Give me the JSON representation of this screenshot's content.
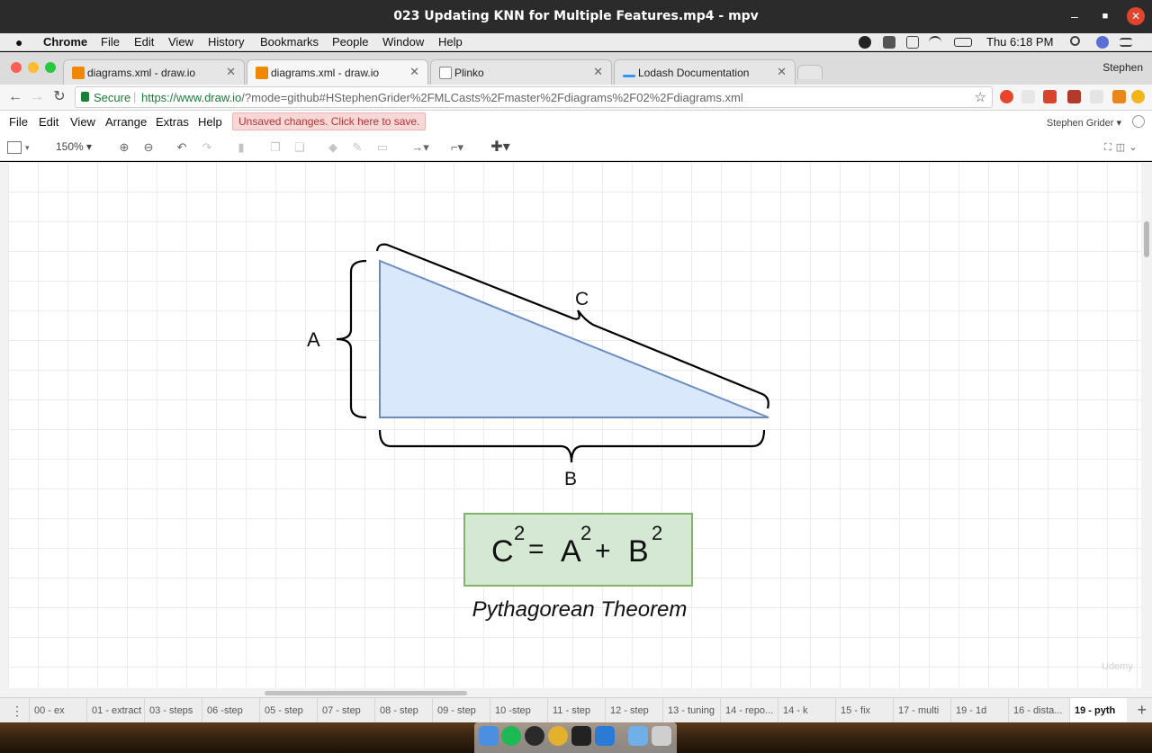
{
  "window": {
    "title": "023 Updating KNN for Multiple Features.mp4 - mpv",
    "minimize": "–",
    "maximize": "■",
    "close": "✕"
  },
  "menubar": {
    "app": "Chrome",
    "items": [
      "File",
      "Edit",
      "View",
      "History",
      "Bookmarks",
      "People",
      "Window",
      "Help"
    ],
    "clock": "Thu 6:18 PM"
  },
  "tabs": [
    {
      "label": "diagrams.xml - draw.io",
      "icon_color": "#f08705"
    },
    {
      "label": "diagrams.xml - draw.io",
      "icon_color": "#f08705"
    },
    {
      "label": "Plinko",
      "icon_color": "#ffffff"
    },
    {
      "label": "Lodash Documentation",
      "icon_color": "#3492ff"
    }
  ],
  "profile": "Stephen",
  "address": {
    "secure": "Secure",
    "url_host": "https://www.draw.io",
    "url_rest": "/?mode=github#HStephenGrider%2FMLCasts%2Fmaster%2Fdiagrams%2F02%2Fdiagrams.xml"
  },
  "drawio_menu": {
    "items": [
      "File",
      "Edit",
      "View",
      "Arrange",
      "Extras",
      "Help"
    ],
    "unsaved": "Unsaved changes. Click here to save.",
    "account": "Stephen Grider ▾"
  },
  "drawio_toolbar": {
    "zoom": "150% ▾"
  },
  "diagram": {
    "label_a": "A",
    "label_b": "B",
    "label_c": "C",
    "formula": {
      "c": "C",
      "eq": "=",
      "a": "A",
      "plus": "+",
      "b": "B",
      "exp": "2"
    },
    "caption": "Pythagorean Theorem",
    "watermark": "Udemy",
    "colors": {
      "triangle_fill": "#dae8fc",
      "triangle_stroke": "#6c8ebf",
      "formula_fill": "#d5e8d4",
      "formula_stroke": "#82b366"
    }
  },
  "page_tabs": [
    "00 - ex",
    "01 - extract",
    "03 - steps",
    "06 -step",
    "05 - step",
    "07 - step",
    "08 - step",
    "09 - step",
    "10 -step",
    "11 - step",
    "12 - step",
    "13 - tuning",
    "14 - repo...",
    "14 - k",
    "15 - fix",
    "17 - multi",
    "19 - 1d",
    "16 - dista...",
    "19 - pyth"
  ],
  "page_menu": "⋮",
  "add_page": "+"
}
